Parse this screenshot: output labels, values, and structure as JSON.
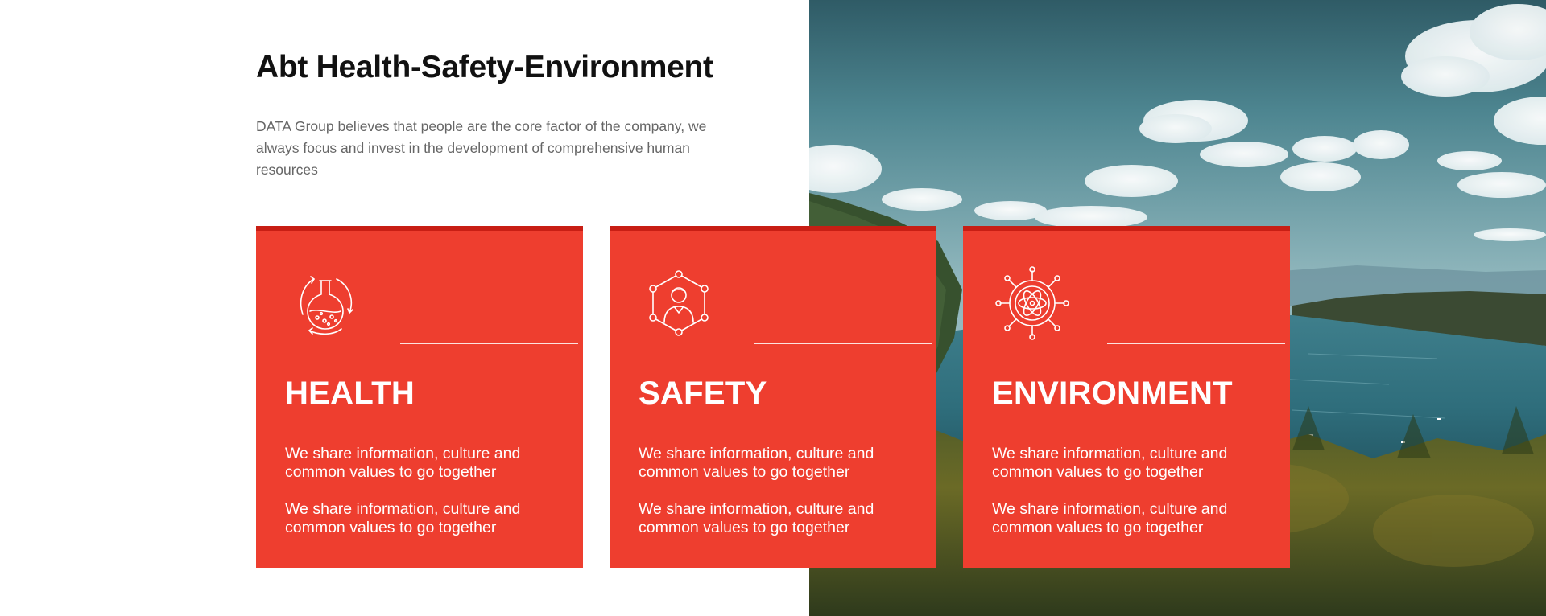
{
  "intro": {
    "title": "Abt Health-Safety-Environment",
    "text": "DATA Group believes that people are the core factor of the company, we always focus and invest in the development of comprehensive human resources"
  },
  "cards": [
    {
      "icon": "flask-cycle-icon",
      "title": "HEALTH",
      "paragraphs": [
        "We share information, culture and common values to go together",
        "We share information, culture and common values to go together"
      ]
    },
    {
      "icon": "person-network-icon",
      "title": "SAFETY",
      "paragraphs": [
        "We share information, culture and common values to go together",
        "We share information, culture and common values to go together"
      ]
    },
    {
      "icon": "atom-network-icon",
      "title": "ENVIRONMENT",
      "paragraphs": [
        "We share information, culture and common values to go together",
        "We share information, culture and common values to go together"
      ]
    }
  ],
  "colors": {
    "card_red": "#ee3e2f",
    "card_top_border": "#c81e14",
    "title_text": "#111111",
    "body_text": "#666666"
  },
  "image": {
    "icon": "lake-forest-landscape-image"
  }
}
